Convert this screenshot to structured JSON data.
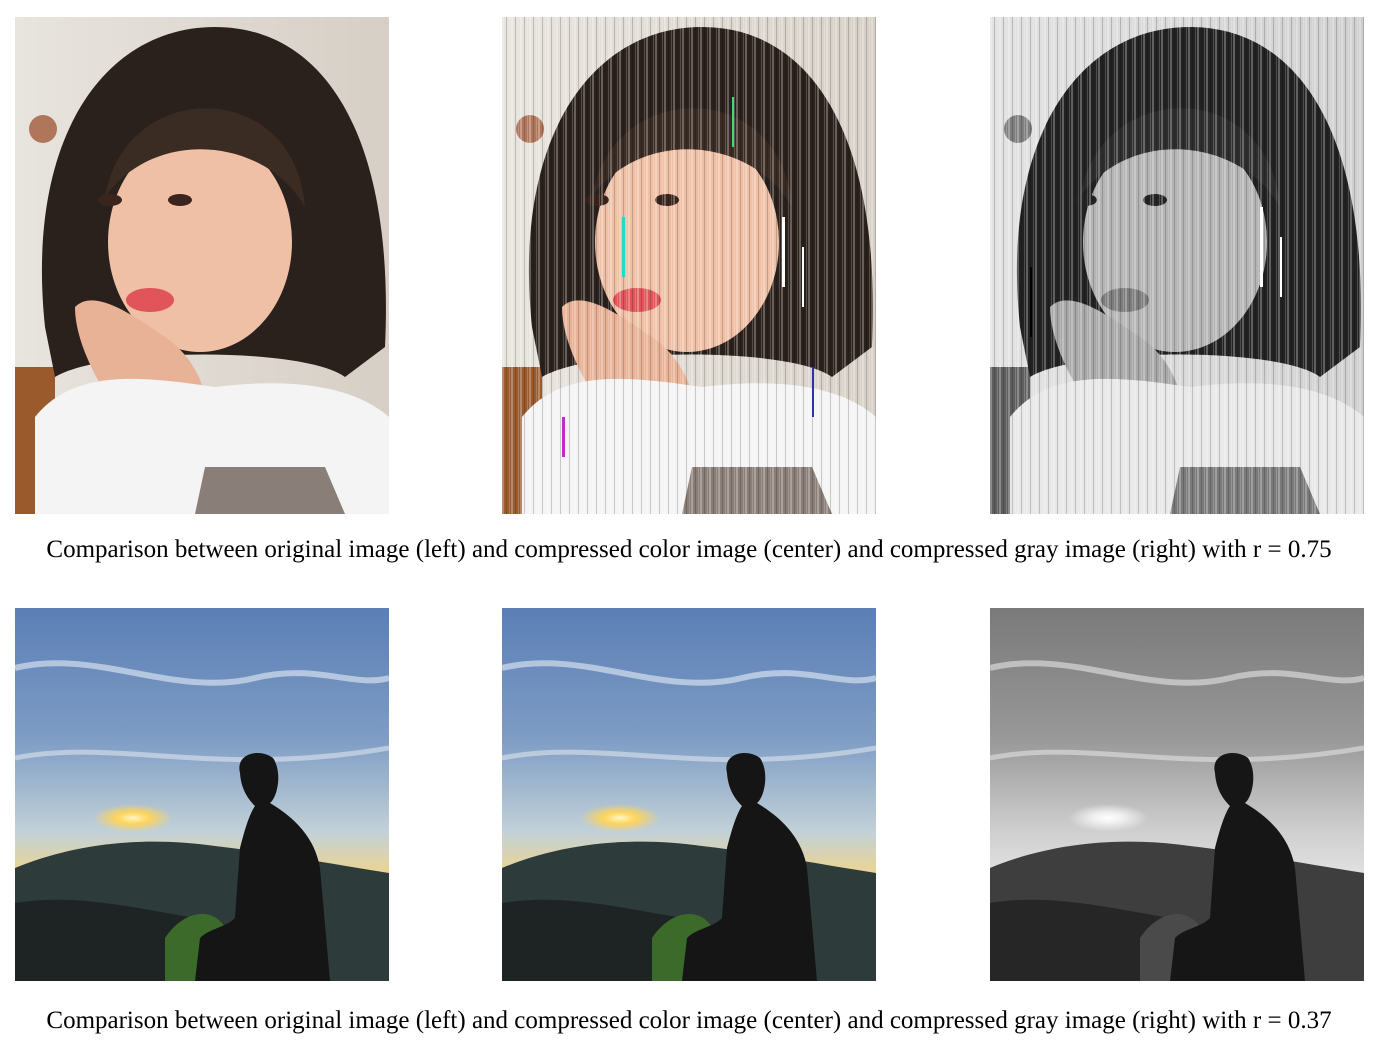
{
  "figure1": {
    "caption": "Comparison between original image (left) and compressed color image (center) and compressed gray image (right) with r = 0.75",
    "images": [
      {
        "subject": "portrait of a girl with shoulder-length dark hair, hand on chin",
        "variant": "original color"
      },
      {
        "subject": "portrait of a girl with shoulder-length dark hair, hand on chin",
        "variant": "compressed color with vertical streak artifacts"
      },
      {
        "subject": "portrait of a girl with shoulder-length dark hair, hand on chin",
        "variant": "compressed grayscale with vertical streak artifacts"
      }
    ]
  },
  "figure2": {
    "caption": "Comparison between original image (left) and compressed color image (center) and compressed gray image (right) with r = 0.37",
    "images": [
      {
        "subject": "silhouette of a man sitting on a hill at sunset over the sea",
        "variant": "original color"
      },
      {
        "subject": "silhouette of a man sitting on a hill at sunset over the sea",
        "variant": "compressed color"
      },
      {
        "subject": "silhouette of a man sitting on a hill at sunset over the sea",
        "variant": "compressed grayscale"
      }
    ]
  },
  "colors": {
    "hair": "#2b211c",
    "skin": "#efc0a6",
    "lips": "#e0545a",
    "shirt": "#f4f4f4",
    "sky_top": "#5f82b8",
    "sky_mid": "#b8cbd6",
    "sun": "#ffd45a",
    "hill": "#2e3b3b"
  }
}
